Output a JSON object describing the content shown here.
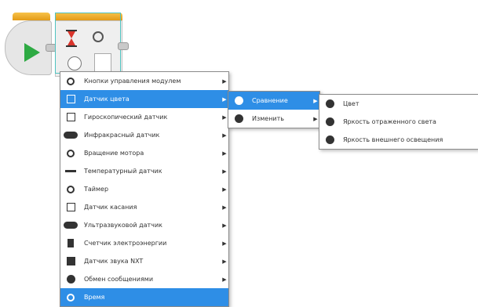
{
  "canvas": {
    "start_block": {
      "icon": "play-icon"
    },
    "wait_block": {
      "icon": "hourglass-icon",
      "mode_icon": "clock-icon"
    }
  },
  "menu_main": {
    "items": [
      {
        "label": "Кнопки управления модулем",
        "icon": "brick-buttons-icon",
        "selected": false
      },
      {
        "label": "Датчик цвета",
        "icon": "color-sensor-icon",
        "selected": true
      },
      {
        "label": "Гироскопический датчик",
        "icon": "gyro-sensor-icon",
        "selected": false
      },
      {
        "label": "Инфракрасный датчик",
        "icon": "infrared-sensor-icon",
        "selected": false
      },
      {
        "label": "Вращение мотора",
        "icon": "motor-rotation-icon",
        "selected": false
      },
      {
        "label": "Температурный датчик",
        "icon": "temperature-sensor-icon",
        "selected": false
      },
      {
        "label": "Таймер",
        "icon": "timer-icon",
        "selected": false
      },
      {
        "label": "Датчик касания",
        "icon": "touch-sensor-icon",
        "selected": false
      },
      {
        "label": "Ультразвуковой датчик",
        "icon": "ultrasonic-sensor-icon",
        "selected": false
      },
      {
        "label": "Счетчик электроэнергии",
        "icon": "energy-meter-icon",
        "selected": false
      },
      {
        "label": "Датчик звука NXT",
        "icon": "sound-sensor-icon",
        "selected": false
      },
      {
        "label": "Обмен сообщениями",
        "icon": "messaging-icon",
        "selected": false
      },
      {
        "label": "Время",
        "icon": "time-icon",
        "selected": true
      }
    ]
  },
  "menu_color": {
    "items": [
      {
        "label": "Сравнение",
        "icon": "compare-icon",
        "selected": true
      },
      {
        "label": "Изменить",
        "icon": "change-icon",
        "selected": false
      }
    ]
  },
  "menu_compare": {
    "items": [
      {
        "label": "Цвет",
        "icon": "color-icon"
      },
      {
        "label": "Яркость отраженного света",
        "icon": "reflected-light-icon"
      },
      {
        "label": "Яркость внешнего освещения",
        "icon": "ambient-light-icon"
      }
    ]
  },
  "colors": {
    "selection": "#2e8ee6",
    "block_orange": "#f0b030",
    "play_green": "#2eaa43"
  }
}
